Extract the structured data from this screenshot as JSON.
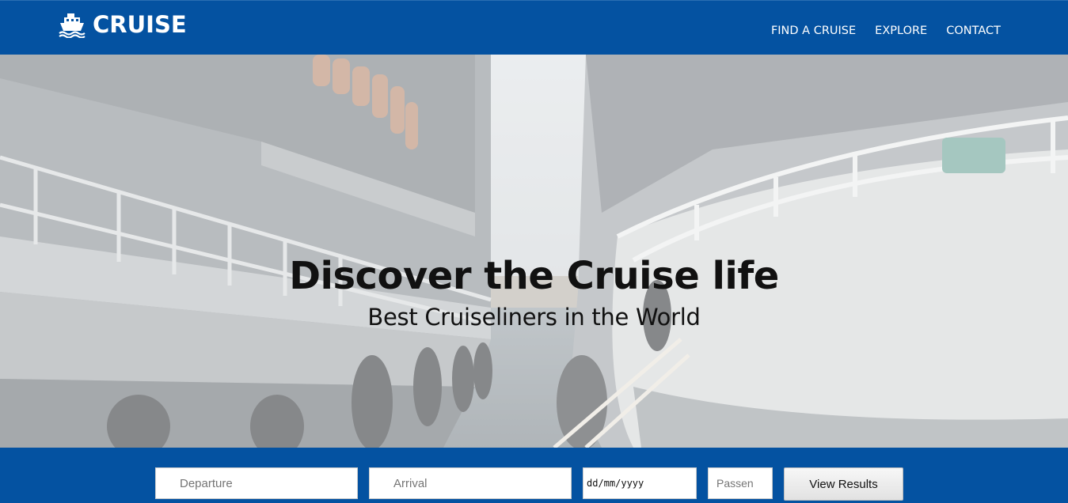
{
  "brand": {
    "name": "CRUISE",
    "icon": "ship-icon"
  },
  "nav": {
    "items": [
      "FIND A CRUISE",
      "EXPLORE",
      "CONTACT"
    ]
  },
  "hero": {
    "title": "Discover the Cruise life",
    "subtitle": "Best Cruiseliners in the World"
  },
  "search": {
    "departure_placeholder": "Departure",
    "arrival_placeholder": "Arrival",
    "date_value": "dd/mm/yyyy",
    "passengers_placeholder": "Passen",
    "submit_label": "View Results"
  },
  "colors": {
    "brand_blue": "#0452a1",
    "white": "#ffffff"
  }
}
